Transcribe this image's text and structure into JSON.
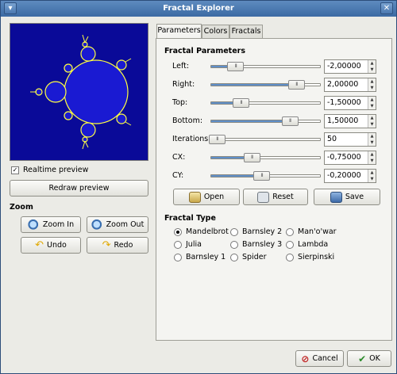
{
  "window": {
    "title": "Fractal Explorer"
  },
  "preview": {
    "realtime_label": "Realtime preview",
    "realtime_checked": true,
    "redraw_label": "Redraw preview",
    "bg_color": "#0a0a98",
    "set_color": "#1a1ad2",
    "edge_color": "#ffff40"
  },
  "zoom": {
    "title": "Zoom",
    "zoom_in": "Zoom In",
    "zoom_out": "Zoom Out",
    "undo": "Undo",
    "redo": "Redo"
  },
  "tabs": [
    "Parameters",
    "Colors",
    "Fractals"
  ],
  "params": {
    "title": "Fractal Parameters",
    "rows": [
      {
        "label": "Left:",
        "value": "-2,00000",
        "level": 0.22
      },
      {
        "label": "Right:",
        "value": "2,00000",
        "level": 0.78
      },
      {
        "label": "Top:",
        "value": "-1,50000",
        "level": 0.27
      },
      {
        "label": "Bottom:",
        "value": "1,50000",
        "level": 0.72
      },
      {
        "label": "Iterations:",
        "value": "50",
        "level": 0.05
      },
      {
        "label": "CX:",
        "value": "-0,75000",
        "level": 0.37
      },
      {
        "label": "CY:",
        "value": "-0,20000",
        "level": 0.46
      }
    ]
  },
  "file_buttons": {
    "open": "Open",
    "reset": "Reset",
    "save": "Save"
  },
  "fractal_type": {
    "title": "Fractal Type",
    "options": [
      {
        "label": "Mandelbrot",
        "selected": true
      },
      {
        "label": "Barnsley 2",
        "selected": false
      },
      {
        "label": "Man'o'war",
        "selected": false
      },
      {
        "label": "Julia",
        "selected": false
      },
      {
        "label": "Barnsley 3",
        "selected": false
      },
      {
        "label": "Lambda",
        "selected": false
      },
      {
        "label": "Barnsley 1",
        "selected": false
      },
      {
        "label": "Spider",
        "selected": false
      },
      {
        "label": "Sierpinski",
        "selected": false
      }
    ]
  },
  "dialog": {
    "cancel": "Cancel",
    "ok": "OK"
  },
  "colors": {
    "title_bar": "#3b6aa3",
    "accent": "#5f8fc9"
  }
}
